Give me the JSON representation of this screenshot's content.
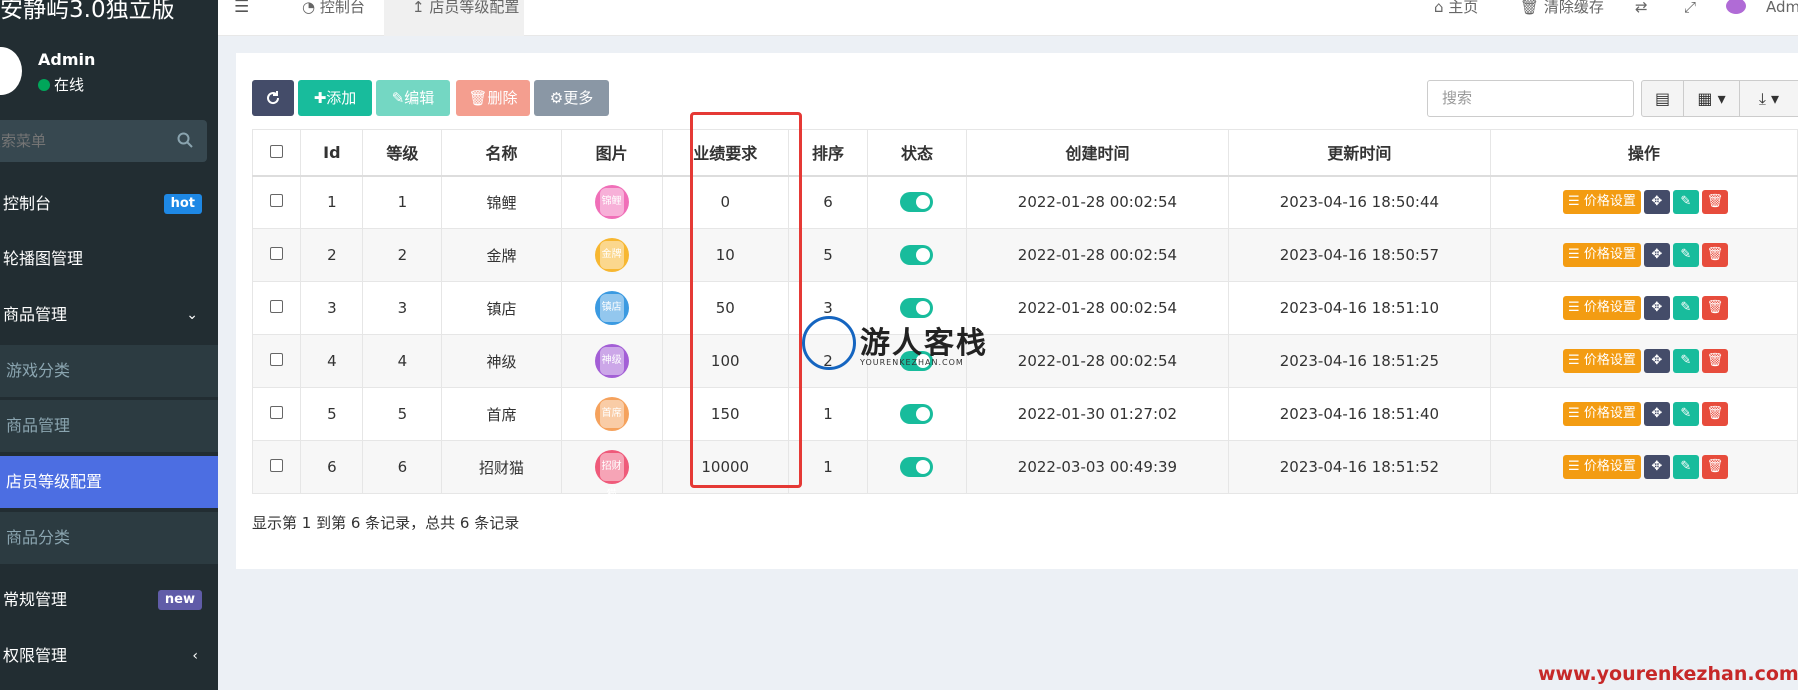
{
  "app": {
    "title": "安静屿3.0独立版"
  },
  "user": {
    "name": "Admin",
    "status": "在线"
  },
  "sidebar": {
    "search_placeholder": "搜索菜单",
    "items": [
      {
        "label": "控制台",
        "badge": "hot"
      },
      {
        "label": "轮播图管理"
      },
      {
        "label": "商品管理"
      },
      {
        "label": "游戏分类"
      },
      {
        "label": "商品管理"
      },
      {
        "label": "店员等级配置"
      },
      {
        "label": "商品分类"
      },
      {
        "label": "常规管理",
        "badge": "new"
      },
      {
        "label": "权限管理"
      }
    ]
  },
  "topbar": {
    "menu_icon": "☰",
    "tab1": "控制台",
    "tab2": "店员等级配置",
    "home": "主页",
    "clear_cache": "清除缓存",
    "admin": "Admin"
  },
  "toolbar": {
    "add": "添加",
    "edit": "编辑",
    "delete": "删除",
    "more": "更多",
    "search_placeholder": "搜索"
  },
  "table": {
    "headers": [
      "Id",
      "等级",
      "名称",
      "图片",
      "业绩要求",
      "排序",
      "状态",
      "创建时间",
      "更新时间",
      "操作"
    ],
    "rows": [
      {
        "id": "1",
        "level": "1",
        "name": "锦鲤",
        "img_label": "锦鲤",
        "img_color": "#f06fb8",
        "req": "0",
        "sort": "6",
        "created": "2022-01-28 00:02:54",
        "updated": "2023-04-16 18:50:44"
      },
      {
        "id": "2",
        "level": "2",
        "name": "金牌",
        "img_label": "金牌",
        "img_color": "#f7b731",
        "req": "10",
        "sort": "5",
        "created": "2022-01-28 00:02:54",
        "updated": "2023-04-16 18:50:57"
      },
      {
        "id": "3",
        "level": "3",
        "name": "镇店",
        "img_label": "镇店",
        "img_color": "#3b9ae1",
        "req": "50",
        "sort": "3",
        "created": "2022-01-28 00:02:54",
        "updated": "2023-04-16 18:51:10"
      },
      {
        "id": "4",
        "level": "4",
        "name": "神级",
        "img_label": "神级",
        "img_color": "#a35fd6",
        "req": "100",
        "sort": "2",
        "created": "2022-01-28 00:02:54",
        "updated": "2023-04-16 18:51:25"
      },
      {
        "id": "5",
        "level": "5",
        "name": "首席",
        "img_label": "首席",
        "img_color": "#f5a25d",
        "req": "150",
        "sort": "1",
        "created": "2022-01-30 01:27:02",
        "updated": "2023-04-16 18:51:40"
      },
      {
        "id": "6",
        "level": "6",
        "name": "招财猫",
        "img_label": "招财猫",
        "img_color": "#ef5a7a",
        "req": "10000",
        "sort": "1",
        "created": "2022-03-03 00:49:39",
        "updated": "2023-04-16 18:51:52"
      }
    ],
    "price_btn": "价格设置"
  },
  "pagination_info": "显示第 1 到第 6 条记录，总共 6 条记录",
  "watermark": {
    "title": "游人客栈",
    "sub": "YOURENKEZHAN.COM",
    "url": "www.yourenkezhan.com"
  }
}
